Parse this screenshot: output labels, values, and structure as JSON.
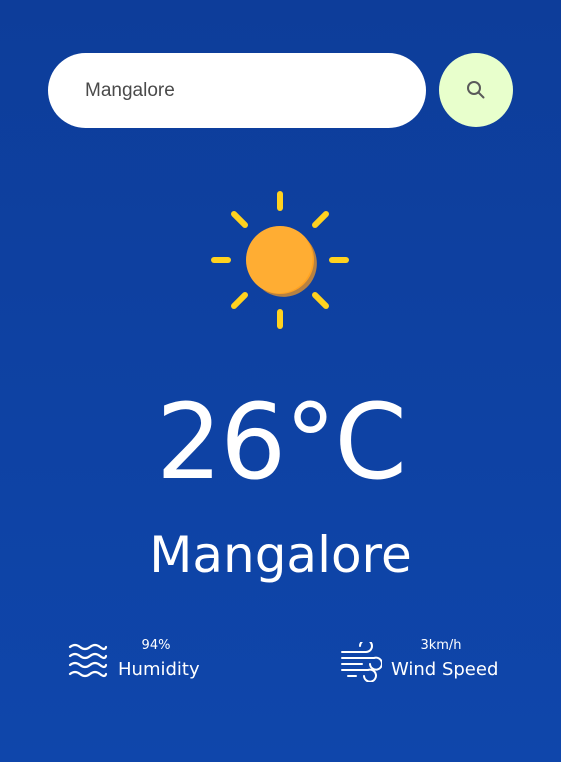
{
  "search": {
    "value": "Mangalore",
    "icon": "search-icon"
  },
  "weather": {
    "icon": "sun-icon",
    "temperature": "26°C",
    "city": "Mangalore"
  },
  "details": {
    "humidity": {
      "icon": "humidity-waves-icon",
      "value": "94%",
      "label": "Humidity"
    },
    "wind": {
      "icon": "wind-icon",
      "value": "3km/h",
      "label": "Wind Speed"
    }
  },
  "colors": {
    "background": "#0f46ab",
    "search_button": "#e8ffcc",
    "sun_core": "#ffad33",
    "sun_rays": "#ffd21f"
  }
}
